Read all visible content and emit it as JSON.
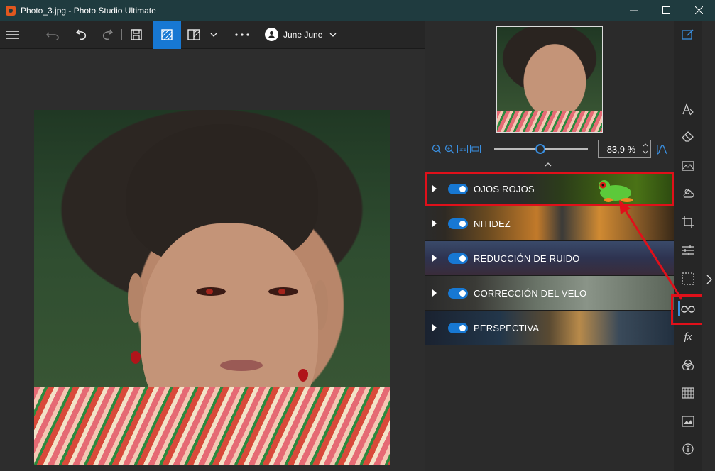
{
  "window": {
    "title": "Photo_3.jpg - Photo Studio Ultimate",
    "minimize_icon": "minimize-icon",
    "maximize_icon": "maximize-icon",
    "close_icon": "close-icon"
  },
  "toolbar": {
    "user_name": "June June",
    "buttons": [
      "menu-icon",
      "undo-all-icon",
      "undo-icon",
      "redo-icon",
      "save-icon",
      "single-view-icon",
      "split-view-icon",
      "more-icon"
    ]
  },
  "zoom": {
    "value": "83,9 %",
    "level": 0.42
  },
  "effects": [
    {
      "label": "OJOS ROJOS",
      "enabled": true
    },
    {
      "label": "NITIDEZ",
      "enabled": true
    },
    {
      "label": "REDUCCIÓN DE RUIDO",
      "enabled": true
    },
    {
      "label": "CORRECCIÓN DEL VELO",
      "enabled": true
    },
    {
      "label": "PERSPECTIVA",
      "enabled": true
    }
  ],
  "sidebar_icons": [
    "edit-icon",
    "text-icon",
    "eraser-icon",
    "panorama-icon",
    "weather-icon",
    "crop-icon",
    "adjust-icon",
    "selection-icon",
    "glasses-icon",
    "fx-icon",
    "color-mix-icon",
    "grid-icon",
    "image-icon",
    "info-icon"
  ],
  "colors": {
    "accent": "#1778d3",
    "highlight": "#e0101a",
    "titlebar": "#1f3b3f"
  }
}
